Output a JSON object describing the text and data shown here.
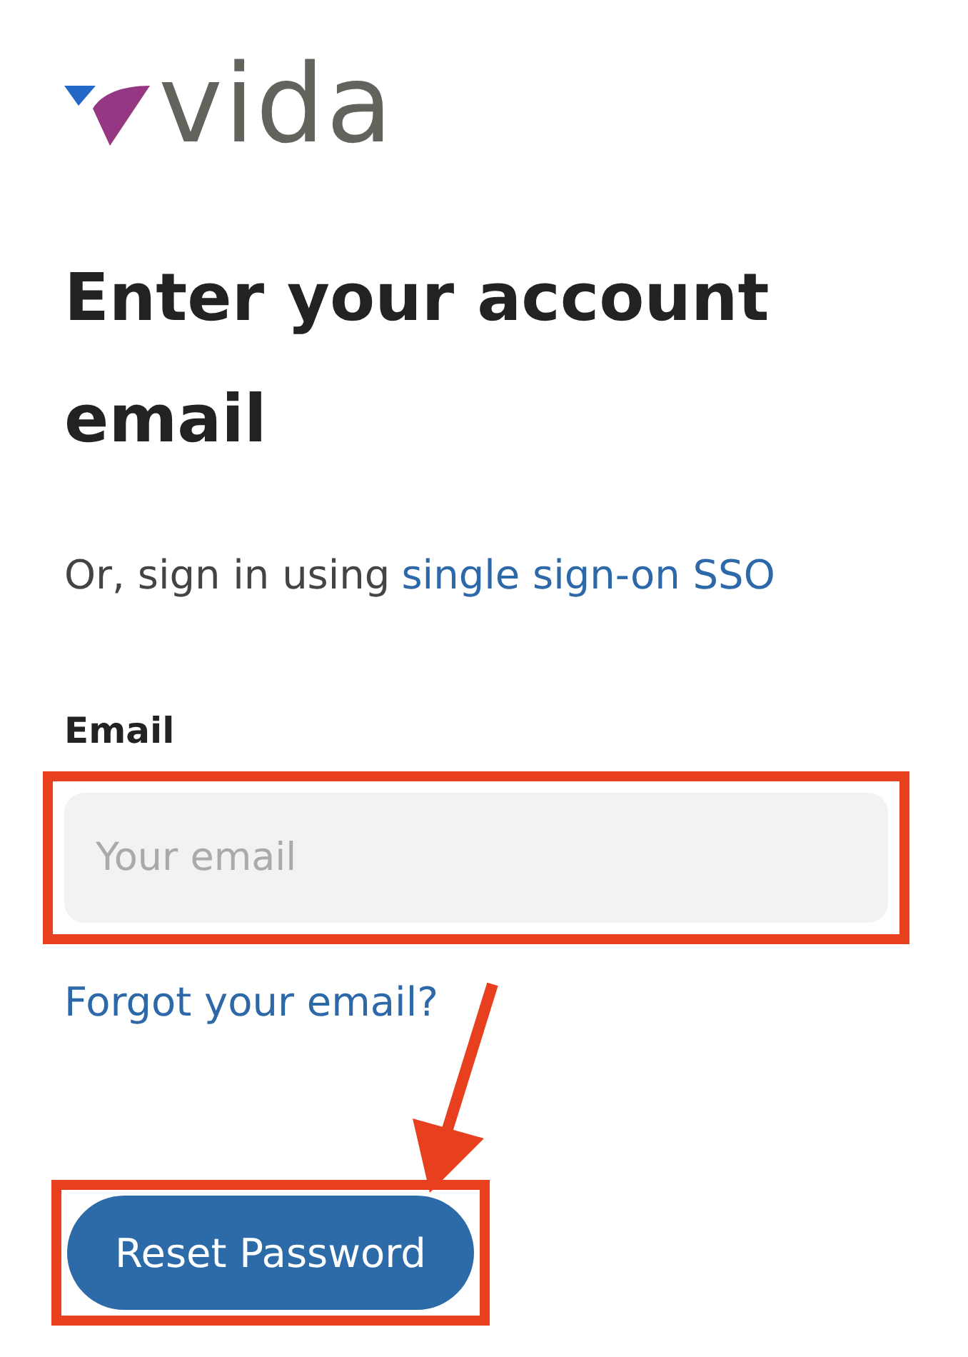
{
  "logo": {
    "wordmark": "vida"
  },
  "heading": "Enter your account email",
  "sso": {
    "prefix": "Or, sign in using",
    "link": "single sign-on SSO"
  },
  "email": {
    "label": "Email",
    "placeholder": "Your email"
  },
  "forgot_link": "Forgot your email?",
  "button": "Reset Password"
}
